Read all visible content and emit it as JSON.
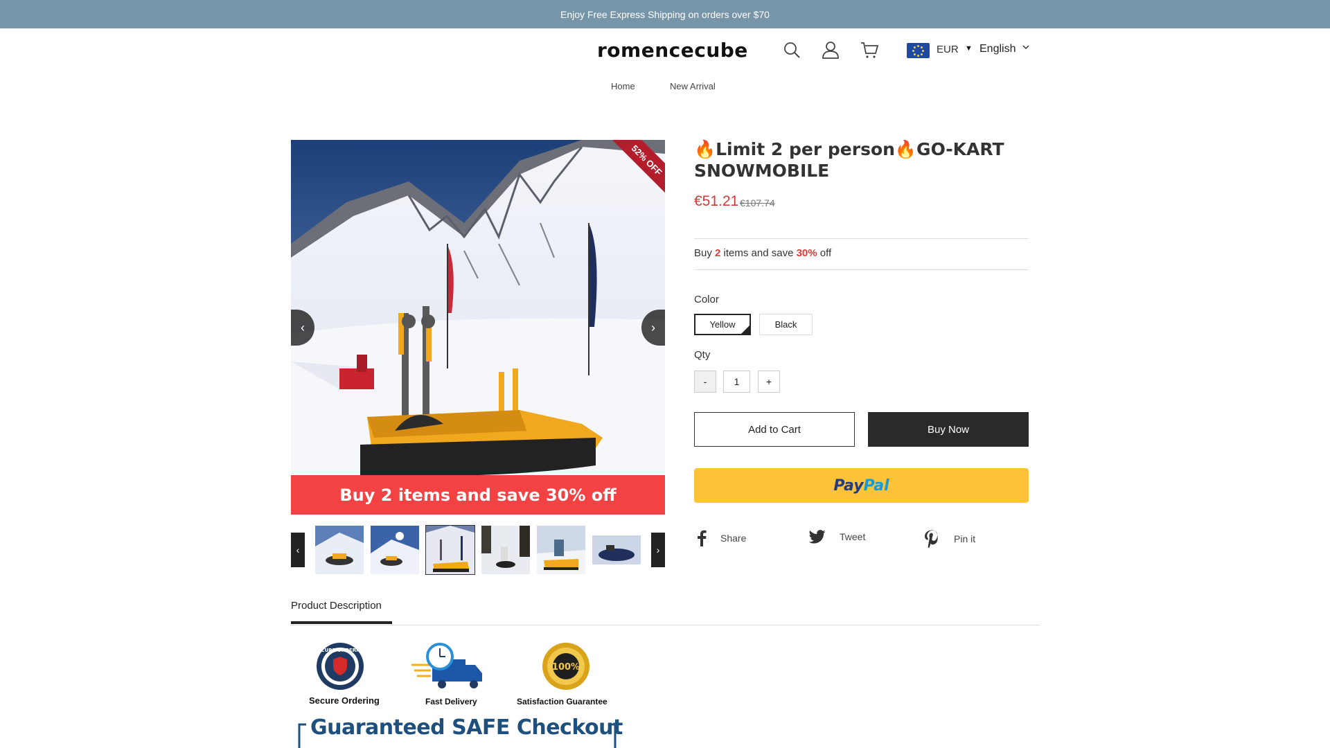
{
  "announcement": "Enjoy Free Express Shipping on orders over $70",
  "header": {
    "logo": "romencecube",
    "icons": [
      "search-icon",
      "account-icon",
      "cart-icon"
    ],
    "currency": "EUR",
    "language": "English"
  },
  "nav": [
    "Home",
    "New Arrival"
  ],
  "gallery": {
    "discount_ribbon": "52% OFF",
    "promo_banner": "Buy 2 items and save 30% off",
    "thumbnail_count": 6,
    "active_thumbnail": 3
  },
  "product": {
    "title": "🔥Limit 2 per person🔥GO-KART SNOWMOBILE",
    "price": "€51.21",
    "original_price": "€107.74",
    "bundle": {
      "pre": "Buy ",
      "qty": "2",
      "mid": " items and save ",
      "pct": "30%",
      "post": " off"
    },
    "color_label": "Color",
    "colors": [
      "Yellow",
      "Black"
    ],
    "selected_color": "Yellow",
    "qty_label": "Qty",
    "qty_minus": "-",
    "qty_value": "1",
    "qty_plus": "+",
    "add_to_cart": "Add to Cart",
    "buy_now": "Buy Now",
    "paypal_a": "Pay",
    "paypal_b": "Pal"
  },
  "share": {
    "facebook": "Share",
    "twitter": "Tweet",
    "pinterest": "Pin it"
  },
  "description": {
    "tab": "Product Description",
    "badges": [
      "Secure Ordering",
      "Fast Delivery",
      "Satisfaction Guarantee"
    ],
    "seal_text": "SECURE ORDERING",
    "guarantee_seal": "100%",
    "safe_checkout": "Guaranteed SAFE Checkout"
  },
  "colors": {
    "announce_bg": "#7795a8",
    "price": "#d03a3a",
    "promo": "#f24243",
    "paypal": "#fcc33a"
  }
}
